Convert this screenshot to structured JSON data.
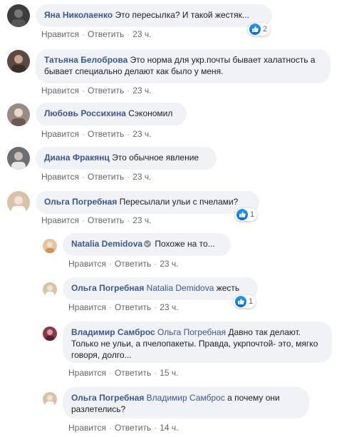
{
  "comments": [
    {
      "author": "Яна Николаенко",
      "text": "Это пересылка? И такой жестяк...",
      "like_label": "Нравится",
      "reply_label": "Ответить",
      "time": "23 ч.",
      "reaction_count": "2",
      "avatar_color": "#3d3d3d"
    },
    {
      "author": "Татьяна Белоброва",
      "text": "Это норма для укр.почты бывает халатность а бывает специально делают как было у меня.",
      "like_label": "Нравится",
      "reply_label": "Ответить",
      "time": "23 ч.",
      "avatar_color": "#5a4a42"
    },
    {
      "author": "Любовь Россихина",
      "text": "Сэкономил",
      "like_label": "Нравится",
      "reply_label": "Ответить",
      "time": "23 ч.",
      "avatar_color": "#9a8a80"
    },
    {
      "author": "Диана Фракянц",
      "text": "Это обычное явление",
      "like_label": "Нравится",
      "reply_label": "Ответить",
      "time": "23 ч.",
      "avatar_color": "#6b6f73"
    },
    {
      "author": "Ольга Погребная",
      "text": "Пересылали ульи с пчелами?",
      "like_label": "Нравится",
      "reply_label": "Ответить",
      "time": "23 ч.",
      "reaction_count": "1",
      "avatar_color": "#d9c2a8"
    }
  ],
  "replies": [
    {
      "author": "Natalia Demidova",
      "text": "Похоже на то...",
      "like_label": "Нравится",
      "reply_label": "Ответить",
      "time": "23 ч.",
      "avatar_color": "#e6c49a"
    },
    {
      "author": "Ольга Погребная",
      "mention": "Natalia Demidova",
      "text": "жесть",
      "like_label": "Нравится",
      "reply_label": "Ответить",
      "time": "23 ч.",
      "reaction_count": "1",
      "avatar_color": "#d9c2a8"
    },
    {
      "author": "Владимир Самброс",
      "mention": "Ольга Погребная",
      "text": "Давно так делают. Только не ульи, а пчелопакеты. Правда, укрпочтой- это, мягко говоря, долго...",
      "like_label": "Нравится",
      "reply_label": "Ответить",
      "time": "15 ч.",
      "avatar_color": "#8a3a4a"
    },
    {
      "author": "Ольга Погребная",
      "mention": "Владимир Самброс",
      "text": "а почему они разлетелись?",
      "like_label": "Нравится",
      "reply_label": "Ответить",
      "time": "14 ч.",
      "avatar_color": "#d9c2a8"
    }
  ],
  "colors": {
    "bubble": "#f0f2f5",
    "name": "#385898",
    "meta": "#65676b",
    "like": "#1877f2"
  },
  "icons": {
    "reaction": "like-thumb-icon",
    "verified": "verified-badge-icon"
  }
}
